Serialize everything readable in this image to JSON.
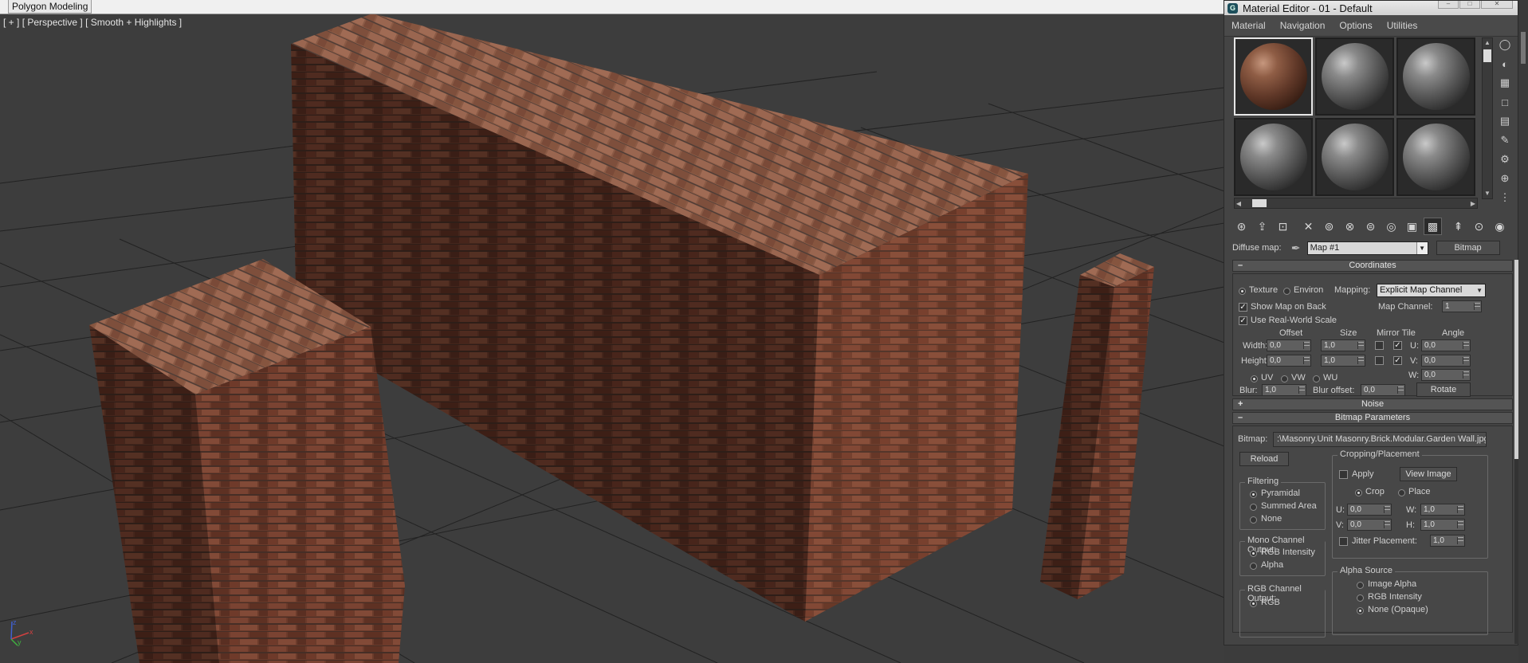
{
  "app": {
    "mode_tab": "Polygon Modeling"
  },
  "viewport": {
    "label_plus": "[ + ]",
    "label_view": "[ Perspective ]",
    "label_shading": "[ Smooth + Highlights ]",
    "axis_labels": {
      "x": "x",
      "y": "y",
      "z": "z"
    }
  },
  "colors": {
    "viewport_bg": "#3d3d3d",
    "grid": "#222222",
    "brick_side": "#6b3b2b",
    "brick_top": "#8a5a45",
    "brick_mortar": "#3a2a24",
    "panel_bg": "#474747"
  },
  "material_editor": {
    "title": "Material Editor - 01 - Default",
    "window_buttons": [
      "–",
      "□",
      "✕"
    ],
    "menu": [
      "Material",
      "Navigation",
      "Options",
      "Utilities"
    ],
    "slots": [
      {
        "type": "brick",
        "active": true
      },
      {
        "type": "grey",
        "active": false
      },
      {
        "type": "grey",
        "active": false
      },
      {
        "type": "grey",
        "active": false
      },
      {
        "type": "grey",
        "active": false
      },
      {
        "type": "grey",
        "active": false
      }
    ],
    "side_tools": [
      "sample-type-icon",
      "backlight-icon",
      "background-icon",
      "uv-tiling-icon",
      "video-check-icon",
      "make-preview-icon",
      "options-icon",
      "select-by-material-icon",
      "material-navigator-icon"
    ],
    "horizontal_tools": [
      "get-material-icon",
      "put-to-scene-icon",
      "assign-to-selection-icon",
      "reset-map-icon",
      "copy-material-icon",
      "make-unique-icon",
      "put-to-library-icon",
      "material-id-icon",
      "show-map-in-viewport-icon",
      "show-end-result-icon",
      "go-to-parent-icon",
      "go-forward-icon"
    ],
    "diffuse_label": "Diffuse map:",
    "map_name": "Map #1",
    "map_type": "Bitmap",
    "coordinates": {
      "header": "Coordinates",
      "texture": "Texture",
      "environ": "Environ",
      "mapping_label": "Mapping:",
      "mapping_value": "Explicit Map Channel",
      "show_map_on_back": "Show Map on Back",
      "use_real_world": "Use Real-World Scale",
      "map_channel_label": "Map Channel:",
      "map_channel_value": "1",
      "offset": "Offset",
      "size": "Size",
      "mirror_tile": "Mirror Tile",
      "angle": "Angle",
      "width": "Width:",
      "height": "Height:",
      "width_offset": "0,0",
      "width_size": "1,0",
      "height_offset": "0,0",
      "height_size": "1,0",
      "u_label": "U:",
      "v_label": "V:",
      "w_label": "W:",
      "u_angle": "0,0",
      "v_angle": "0,0",
      "w_angle": "0,0",
      "uv": "UV",
      "vw": "VW",
      "wu": "WU",
      "blur": "Blur:",
      "blur_value": "1,0",
      "blur_offset": "Blur offset:",
      "blur_offset_value": "0,0",
      "rotate": "Rotate"
    },
    "noise": {
      "header": "Noise",
      "sign": "+"
    },
    "bitmap_params": {
      "header": "Bitmap Parameters",
      "bitmap_label": "Bitmap:",
      "path": ":\\Masonry.Unit Masonry.Brick.Modular.Garden Wall.jpg",
      "reload": "Reload",
      "cropping": "Cropping/Placement",
      "apply": "Apply",
      "view_image": "View Image",
      "crop": "Crop",
      "place": "Place",
      "u": "U:",
      "v": "V:",
      "w": "W:",
      "h": "H:",
      "u_value": "0,0",
      "v_value": "0,0",
      "w_value": "1,0",
      "h_value": "1,0",
      "jitter": "Jitter Placement:",
      "jitter_value": "1,0",
      "filtering": "Filtering",
      "pyramidal": "Pyramidal",
      "summed_area": "Summed Area",
      "none": "None",
      "mono_output": "Mono Channel Output:",
      "rgb_intensity": "RGB Intensity",
      "alpha": "Alpha",
      "rgb_output": "RGB Channel Output:",
      "rgb": "RGB",
      "alpha_source": "Alpha Source",
      "image_alpha": "Image Alpha",
      "alpha_rgb_intensity": "RGB Intensity",
      "none_opaque": "None (Opaque)"
    }
  }
}
